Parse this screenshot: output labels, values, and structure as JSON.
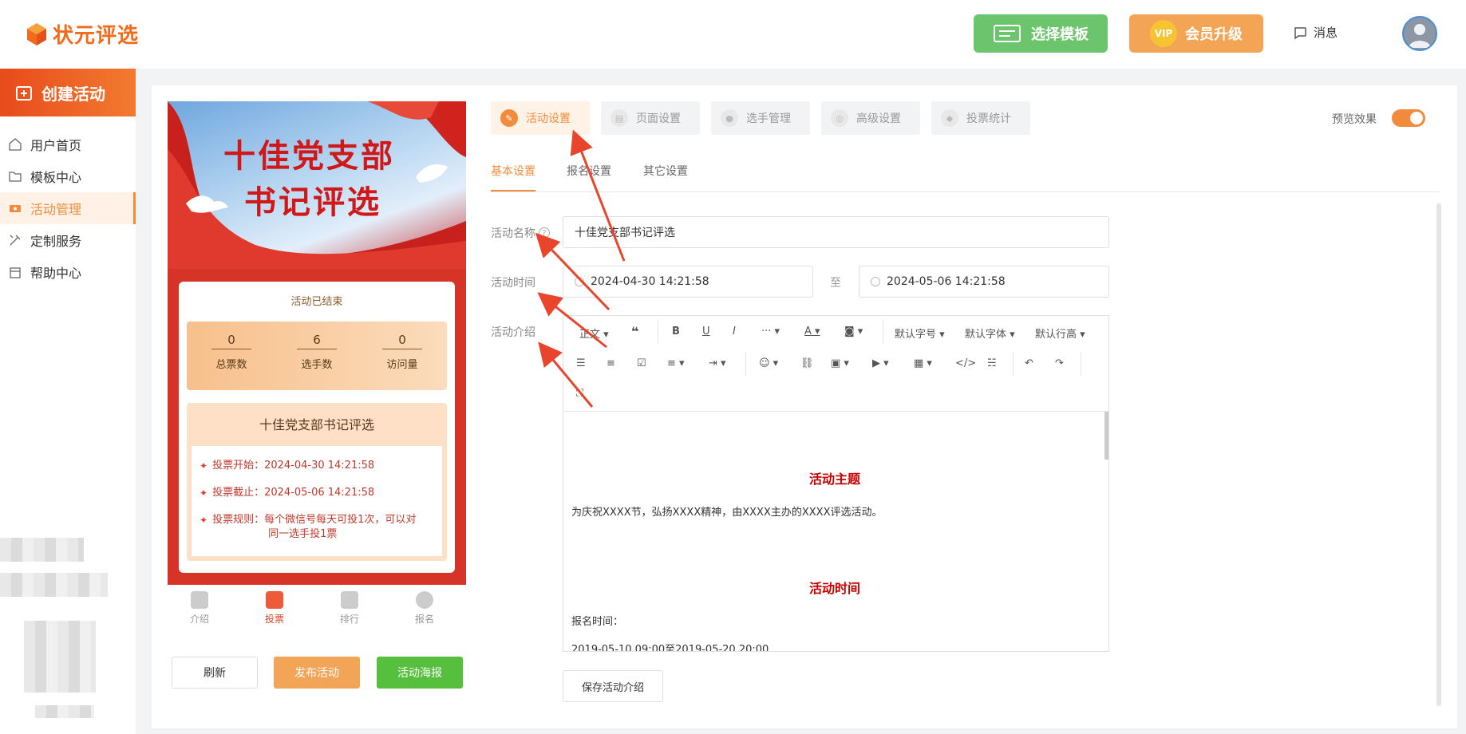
{
  "header": {
    "logo_text": "状元评选",
    "template_button": "选择模板",
    "vip_badge": "VIP",
    "vip_button": "会员升级",
    "message_label": "消息"
  },
  "sidebar": {
    "create_button": "创建活动",
    "items": [
      {
        "label": "用户首页",
        "icon": "home-icon"
      },
      {
        "label": "模板中心",
        "icon": "folder-icon"
      },
      {
        "label": "活动管理",
        "icon": "ticket-icon",
        "active": true
      },
      {
        "label": "定制服务",
        "icon": "tools-icon"
      },
      {
        "label": "帮助中心",
        "icon": "calendar-icon"
      }
    ]
  },
  "preview": {
    "banner_title_line1": "十佳党支部",
    "banner_title_line2": "书记评选",
    "status": "活动已结束",
    "stats": [
      {
        "value": "0",
        "label": "总票数"
      },
      {
        "value": "6",
        "label": "选手数"
      },
      {
        "value": "0",
        "label": "访问量"
      }
    ],
    "info_title": "十佳党支部书记评选",
    "vote_start": "投票开始：2024-04-30 14:21:58",
    "vote_end": "投票截止：2024-05-06 14:21:58",
    "vote_rule_line1": "投票规则：每个微信号每天可投1次，可以对",
    "vote_rule_line2": "同一选手投1票",
    "tabs": [
      "介绍",
      "投票",
      "排行",
      "报名"
    ],
    "active_tab": "投票",
    "buttons": {
      "refresh": "刷新",
      "publish": "发布活动",
      "poster": "活动海报"
    }
  },
  "steps": {
    "tabs": [
      "活动设置",
      "页面设置",
      "选手管理",
      "高级设置",
      "投票统计"
    ],
    "active": "活动设置",
    "preview_label": "预览效果",
    "preview_enabled": true
  },
  "subtabs": {
    "tabs": [
      "基本设置",
      "报名设置",
      "其它设置"
    ],
    "active": "基本设置"
  },
  "form": {
    "name_label": "活动名称",
    "name_value": "十佳党支部书记评选",
    "time_label": "活动时间",
    "time_start": "2024-04-30 14:21:58",
    "time_to": "至",
    "time_end": "2024-05-06 14:21:58",
    "intro_label": "活动介绍"
  },
  "editor": {
    "toolbar": {
      "paragraph": "正文",
      "font_size": "默认字号",
      "font_family": "默认字体",
      "line_height": "默认行高"
    },
    "content": {
      "heading1": "活动主题",
      "para1": "为庆祝XXXX节，弘扬XXXX精神，由XXXX主办的XXXX评选活动。",
      "heading2": "活动时间",
      "para2": "报名时间：",
      "para3": "2019-05-10 09:00至2019-05-20 20:00"
    },
    "save_button": "保存活动介绍"
  },
  "colors": {
    "accent": "#f28c3c",
    "green": "#56c03e",
    "red": "#d63426"
  }
}
